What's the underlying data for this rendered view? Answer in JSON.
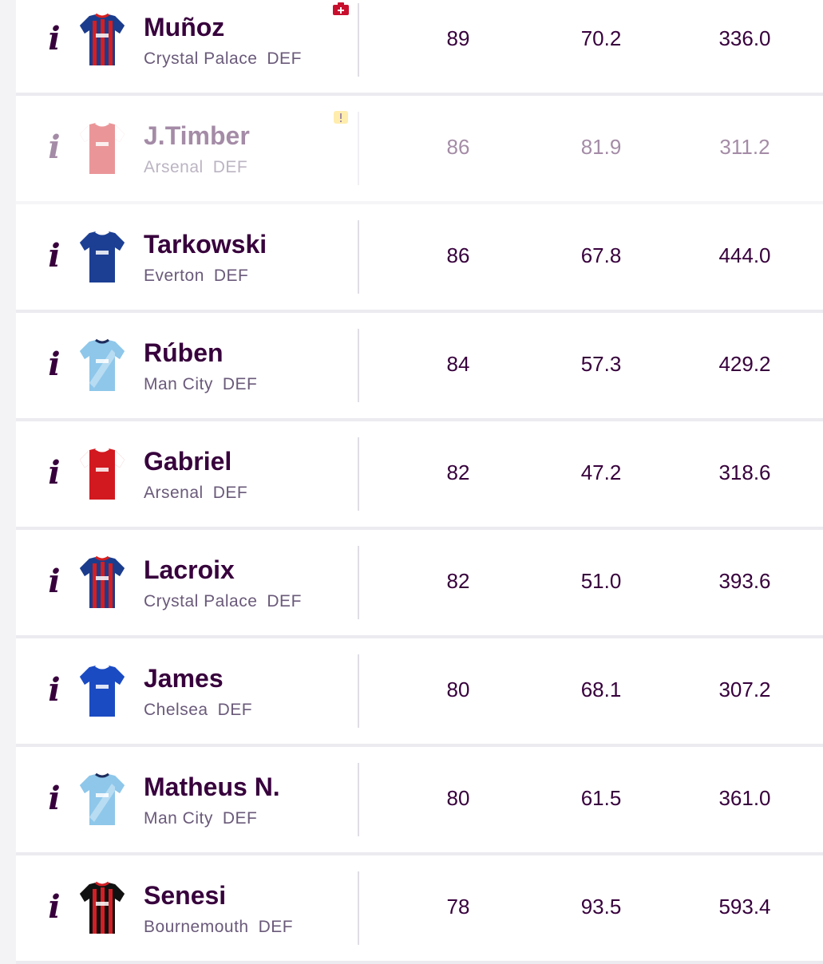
{
  "rows": [
    {
      "name": "Muñoz",
      "team": "Crystal Palace",
      "pos": "DEF",
      "v1": "89",
      "v2": "70.2",
      "v3": "336.0",
      "kit": "palace",
      "flag": "injury",
      "faded": false
    },
    {
      "name": "J.Timber",
      "team": "Arsenal",
      "pos": "DEF",
      "v1": "86",
      "v2": "81.9",
      "v3": "311.2",
      "kit": "arsenal",
      "flag": "warning",
      "faded": true
    },
    {
      "name": "Tarkowski",
      "team": "Everton",
      "pos": "DEF",
      "v1": "86",
      "v2": "67.8",
      "v3": "444.0",
      "kit": "everton",
      "flag": "",
      "faded": false
    },
    {
      "name": "Rúben",
      "team": "Man City",
      "pos": "DEF",
      "v1": "84",
      "v2": "57.3",
      "v3": "429.2",
      "kit": "city",
      "flag": "",
      "faded": false
    },
    {
      "name": "Gabriel",
      "team": "Arsenal",
      "pos": "DEF",
      "v1": "82",
      "v2": "47.2",
      "v3": "318.6",
      "kit": "arsenal",
      "flag": "",
      "faded": false
    },
    {
      "name": "Lacroix",
      "team": "Crystal Palace",
      "pos": "DEF",
      "v1": "82",
      "v2": "51.0",
      "v3": "393.6",
      "kit": "palace",
      "flag": "",
      "faded": false
    },
    {
      "name": "James",
      "team": "Chelsea",
      "pos": "DEF",
      "v1": "80",
      "v2": "68.1",
      "v3": "307.2",
      "kit": "chelsea",
      "flag": "",
      "faded": false
    },
    {
      "name": "Matheus N.",
      "team": "Man City",
      "pos": "DEF",
      "v1": "80",
      "v2": "61.5",
      "v3": "361.0",
      "kit": "city",
      "flag": "",
      "faded": false
    },
    {
      "name": "Senesi",
      "team": "Bournemouth",
      "pos": "DEF",
      "v1": "78",
      "v2": "93.5",
      "v3": "593.4",
      "kit": "bournemouth",
      "flag": "",
      "faded": false
    }
  ],
  "info_glyph": "i",
  "colors": {
    "text_primary": "#37003c",
    "text_secondary": "#6a5a7a",
    "injury_flag": "#c8102e",
    "warning_flag": "#ffd84d"
  }
}
